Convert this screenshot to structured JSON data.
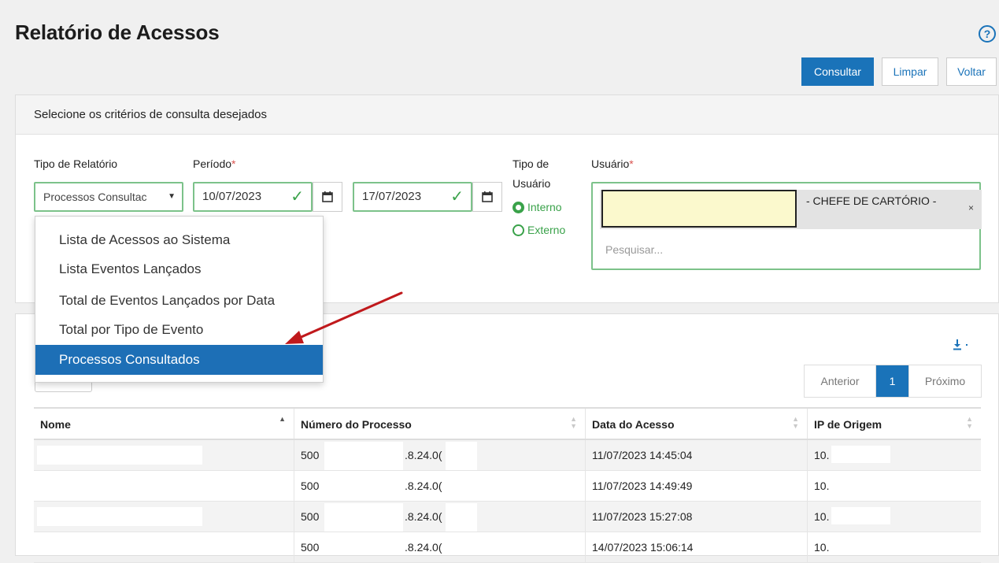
{
  "header": {
    "title": "Relatório de Acessos",
    "help_icon": "?"
  },
  "toolbar": {
    "consultar": "Consultar",
    "limpar": "Limpar",
    "voltar": "Voltar"
  },
  "criteria": {
    "heading": "Selecione os critérios de consulta desejados",
    "tipo_relatorio_label": "Tipo de Relatório",
    "tipo_relatorio_value": "Processos Consultac",
    "periodo_label": "Período",
    "required_mark": "*",
    "periodo_inicio": "10/07/2023",
    "periodo_fim": "17/07/2023",
    "tipo_usuario_label_line1": "Tipo de",
    "tipo_usuario_label_line2": "Usuário",
    "tipo_usuario_options": [
      "Interno",
      "Externo"
    ],
    "tipo_usuario_selected": "Interno",
    "usuario_label": "Usuário",
    "usuario_tag_text": "- CHEFE DE CARTÓRIO -",
    "usuario_tag_close": "×",
    "usuario_search_placeholder": "Pesquisar..."
  },
  "dropdown": {
    "items": [
      "Lista de Acessos ao Sistema",
      "Lista Eventos Lançados",
      "Total de Eventos Lançados por Data",
      "Total por Tipo de Evento",
      "Processos Consultados"
    ],
    "selected_index": 4
  },
  "results": {
    "export_icon": "download-icon",
    "pager": {
      "previous": "Anterior",
      "current": "1",
      "next": "Próximo"
    },
    "columns": [
      "Nome",
      "Número do Processo",
      "Data do Acesso",
      "IP de Origem"
    ],
    "rows": [
      {
        "nome": "",
        "proc_a": "500",
        "proc_b": ".8.24.0(",
        "data": "11/07/2023 14:45:04",
        "ip": "10."
      },
      {
        "nome": "",
        "proc_a": "500",
        "proc_b": ".8.24.0(",
        "data": "11/07/2023 14:49:49",
        "ip": "10."
      },
      {
        "nome": "",
        "proc_a": "500",
        "proc_b": ".8.24.0(",
        "data": "11/07/2023 15:27:08",
        "ip": "10."
      },
      {
        "nome": "",
        "proc_a": "500",
        "proc_b": ".8.24.0(",
        "data": "14/07/2023 15:06:14",
        "ip": "10."
      }
    ]
  },
  "colors": {
    "primary": "#1a73b9",
    "valid_border": "#7cc28a",
    "valid_check": "#3aa24a",
    "dropdown_selected": "#1d6fb6",
    "annotation_arrow": "#c0191c",
    "redaction_fill": "#fbf9cd"
  }
}
